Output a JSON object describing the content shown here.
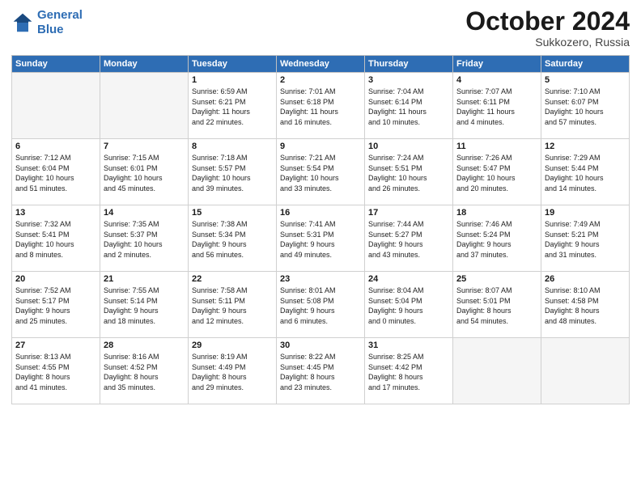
{
  "logo": {
    "line1": "General",
    "line2": "Blue"
  },
  "title": "October 2024",
  "subtitle": "Sukkozero, Russia",
  "headers": [
    "Sunday",
    "Monday",
    "Tuesday",
    "Wednesday",
    "Thursday",
    "Friday",
    "Saturday"
  ],
  "weeks": [
    [
      {
        "day": "",
        "info": "",
        "empty": true
      },
      {
        "day": "",
        "info": "",
        "empty": true
      },
      {
        "day": "1",
        "info": "Sunrise: 6:59 AM\nSunset: 6:21 PM\nDaylight: 11 hours\nand 22 minutes."
      },
      {
        "day": "2",
        "info": "Sunrise: 7:01 AM\nSunset: 6:18 PM\nDaylight: 11 hours\nand 16 minutes."
      },
      {
        "day": "3",
        "info": "Sunrise: 7:04 AM\nSunset: 6:14 PM\nDaylight: 11 hours\nand 10 minutes."
      },
      {
        "day": "4",
        "info": "Sunrise: 7:07 AM\nSunset: 6:11 PM\nDaylight: 11 hours\nand 4 minutes."
      },
      {
        "day": "5",
        "info": "Sunrise: 7:10 AM\nSunset: 6:07 PM\nDaylight: 10 hours\nand 57 minutes."
      }
    ],
    [
      {
        "day": "6",
        "info": "Sunrise: 7:12 AM\nSunset: 6:04 PM\nDaylight: 10 hours\nand 51 minutes."
      },
      {
        "day": "7",
        "info": "Sunrise: 7:15 AM\nSunset: 6:01 PM\nDaylight: 10 hours\nand 45 minutes."
      },
      {
        "day": "8",
        "info": "Sunrise: 7:18 AM\nSunset: 5:57 PM\nDaylight: 10 hours\nand 39 minutes."
      },
      {
        "day": "9",
        "info": "Sunrise: 7:21 AM\nSunset: 5:54 PM\nDaylight: 10 hours\nand 33 minutes."
      },
      {
        "day": "10",
        "info": "Sunrise: 7:24 AM\nSunset: 5:51 PM\nDaylight: 10 hours\nand 26 minutes."
      },
      {
        "day": "11",
        "info": "Sunrise: 7:26 AM\nSunset: 5:47 PM\nDaylight: 10 hours\nand 20 minutes."
      },
      {
        "day": "12",
        "info": "Sunrise: 7:29 AM\nSunset: 5:44 PM\nDaylight: 10 hours\nand 14 minutes."
      }
    ],
    [
      {
        "day": "13",
        "info": "Sunrise: 7:32 AM\nSunset: 5:41 PM\nDaylight: 10 hours\nand 8 minutes."
      },
      {
        "day": "14",
        "info": "Sunrise: 7:35 AM\nSunset: 5:37 PM\nDaylight: 10 hours\nand 2 minutes."
      },
      {
        "day": "15",
        "info": "Sunrise: 7:38 AM\nSunset: 5:34 PM\nDaylight: 9 hours\nand 56 minutes."
      },
      {
        "day": "16",
        "info": "Sunrise: 7:41 AM\nSunset: 5:31 PM\nDaylight: 9 hours\nand 49 minutes."
      },
      {
        "day": "17",
        "info": "Sunrise: 7:44 AM\nSunset: 5:27 PM\nDaylight: 9 hours\nand 43 minutes."
      },
      {
        "day": "18",
        "info": "Sunrise: 7:46 AM\nSunset: 5:24 PM\nDaylight: 9 hours\nand 37 minutes."
      },
      {
        "day": "19",
        "info": "Sunrise: 7:49 AM\nSunset: 5:21 PM\nDaylight: 9 hours\nand 31 minutes."
      }
    ],
    [
      {
        "day": "20",
        "info": "Sunrise: 7:52 AM\nSunset: 5:17 PM\nDaylight: 9 hours\nand 25 minutes."
      },
      {
        "day": "21",
        "info": "Sunrise: 7:55 AM\nSunset: 5:14 PM\nDaylight: 9 hours\nand 18 minutes."
      },
      {
        "day": "22",
        "info": "Sunrise: 7:58 AM\nSunset: 5:11 PM\nDaylight: 9 hours\nand 12 minutes."
      },
      {
        "day": "23",
        "info": "Sunrise: 8:01 AM\nSunset: 5:08 PM\nDaylight: 9 hours\nand 6 minutes."
      },
      {
        "day": "24",
        "info": "Sunrise: 8:04 AM\nSunset: 5:04 PM\nDaylight: 9 hours\nand 0 minutes."
      },
      {
        "day": "25",
        "info": "Sunrise: 8:07 AM\nSunset: 5:01 PM\nDaylight: 8 hours\nand 54 minutes."
      },
      {
        "day": "26",
        "info": "Sunrise: 8:10 AM\nSunset: 4:58 PM\nDaylight: 8 hours\nand 48 minutes."
      }
    ],
    [
      {
        "day": "27",
        "info": "Sunrise: 8:13 AM\nSunset: 4:55 PM\nDaylight: 8 hours\nand 41 minutes."
      },
      {
        "day": "28",
        "info": "Sunrise: 8:16 AM\nSunset: 4:52 PM\nDaylight: 8 hours\nand 35 minutes."
      },
      {
        "day": "29",
        "info": "Sunrise: 8:19 AM\nSunset: 4:49 PM\nDaylight: 8 hours\nand 29 minutes."
      },
      {
        "day": "30",
        "info": "Sunrise: 8:22 AM\nSunset: 4:45 PM\nDaylight: 8 hours\nand 23 minutes."
      },
      {
        "day": "31",
        "info": "Sunrise: 8:25 AM\nSunset: 4:42 PM\nDaylight: 8 hours\nand 17 minutes."
      },
      {
        "day": "",
        "info": "",
        "empty": true
      },
      {
        "day": "",
        "info": "",
        "empty": true
      }
    ]
  ]
}
